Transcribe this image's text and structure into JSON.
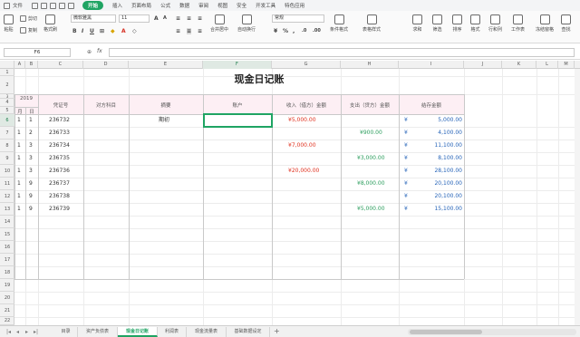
{
  "menubar": {
    "file": "文件",
    "items": [
      "开始",
      "插入",
      "页面布局",
      "公式",
      "数据",
      "审阅",
      "视图",
      "安全",
      "开发工具",
      "特色应用"
    ],
    "active_index": 0
  },
  "ribbon": {
    "paste": "粘贴",
    "cut": "剪切",
    "copy": "复制",
    "format_painter": "格式刷",
    "font_name": "微软雅黑",
    "font_size": "11",
    "merge_center": "合并居中",
    "auto_wrap": "自动换行",
    "number_format": "常规",
    "conditional_format": "条件格式",
    "table_style": "表格样式",
    "sum": "求和",
    "filter": "筛选",
    "sort": "排序",
    "format": "格式",
    "row_col": "行和列",
    "worksheet": "工作表",
    "freeze": "冻结窗格",
    "find": "查找"
  },
  "formula_bar": {
    "name_box": "F6",
    "fx": "fx",
    "value": ""
  },
  "columns": [
    "A",
    "B",
    "C",
    "D",
    "E",
    "F",
    "G",
    "H",
    "I",
    "J",
    "K",
    "L",
    "M"
  ],
  "selected_column": "F",
  "rows": [
    "1",
    "2",
    "3",
    "4",
    "5",
    "6",
    "7",
    "8",
    "9",
    "10",
    "11",
    "12",
    "13",
    "14",
    "15",
    "16",
    "17",
    "18",
    "19",
    "20",
    "21",
    "22"
  ],
  "selected_row": "6",
  "sheet": {
    "title": "现金日记账",
    "year": "2019",
    "month_label": "月",
    "day_label": "日",
    "headers": {
      "voucher": "凭证号",
      "account": "对方科目",
      "summary": "摘要",
      "client": "账户",
      "income": "收入（借方）金额",
      "expense": "支出（贷方）金额",
      "balance": "结存金额"
    },
    "data_rows": [
      {
        "month": "1",
        "day": "1",
        "voucher": "236732",
        "summary": "期初",
        "income": "¥5,000.00",
        "expense": "",
        "currency": "¥",
        "balance": "5,000.00"
      },
      {
        "month": "1",
        "day": "2",
        "voucher": "236733",
        "summary": "",
        "income": "",
        "expense": "¥900.00",
        "currency": "¥",
        "balance": "4,100.00"
      },
      {
        "month": "1",
        "day": "3",
        "voucher": "236734",
        "summary": "",
        "income": "¥7,000.00",
        "expense": "",
        "currency": "¥",
        "balance": "11,100.00"
      },
      {
        "month": "1",
        "day": "3",
        "voucher": "236735",
        "summary": "",
        "income": "",
        "expense": "¥3,000.00",
        "currency": "¥",
        "balance": "8,100.00"
      },
      {
        "month": "1",
        "day": "3",
        "voucher": "236736",
        "summary": "",
        "income": "¥20,000.00",
        "expense": "",
        "currency": "¥",
        "balance": "28,100.00"
      },
      {
        "month": "1",
        "day": "9",
        "voucher": "236737",
        "summary": "",
        "income": "",
        "expense": "¥8,000.00",
        "currency": "¥",
        "balance": "20,100.00"
      },
      {
        "month": "1",
        "day": "9",
        "voucher": "236738",
        "summary": "",
        "income": "",
        "expense": "",
        "currency": "¥",
        "balance": "20,100.00"
      },
      {
        "month": "1",
        "day": "9",
        "voucher": "236739",
        "summary": "",
        "income": "",
        "expense": "¥5,000.00",
        "currency": "¥",
        "balance": "15,100.00"
      }
    ]
  },
  "tabs": [
    "目录",
    "资产负债表",
    "现金日记账",
    "利润表",
    "现金流量表",
    "基础数据设定"
  ],
  "active_tab_index": 2,
  "add_tab": "+",
  "colors": {
    "accent": "#1fa463",
    "income": "#e0301e",
    "expense": "#2a9d5c",
    "balance": "#2563b8",
    "header_fill": "#fdeff4"
  }
}
